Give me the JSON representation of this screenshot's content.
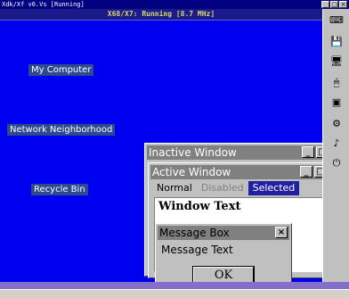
{
  "emulator": {
    "title": "Xdk/Xf v6.Vs [Running]",
    "buttons": [
      "_",
      "□",
      "×"
    ]
  },
  "screen": {
    "title": "X68/X7: Running [8.7 MHz]",
    "background": "#0000f0"
  },
  "desktop_icons": [
    {
      "label": "My Computer"
    },
    {
      "label": "Network Neighborhood"
    },
    {
      "label": "Recycle Bin"
    }
  ],
  "inactive_window": {
    "title": "Inactive Window",
    "title_color": "#808080"
  },
  "active_window": {
    "title": "Active Window",
    "title_color": "#808080",
    "menu": {
      "normal": "Normal",
      "disabled": "Disabled",
      "selected": "Selected"
    },
    "text": "Window Text"
  },
  "message_box": {
    "title": "Message Box",
    "message": "Message Text",
    "ok_label": "OK"
  },
  "window_buttons": {
    "minimize": "_",
    "maximize": "□",
    "close": "×"
  },
  "toolbar_icons": [
    "keyboard-icon",
    "disk-icon",
    "monitor-icon",
    "mouse-icon",
    "chip-icon",
    "settings-icon",
    "sound-icon",
    "power-icon"
  ]
}
